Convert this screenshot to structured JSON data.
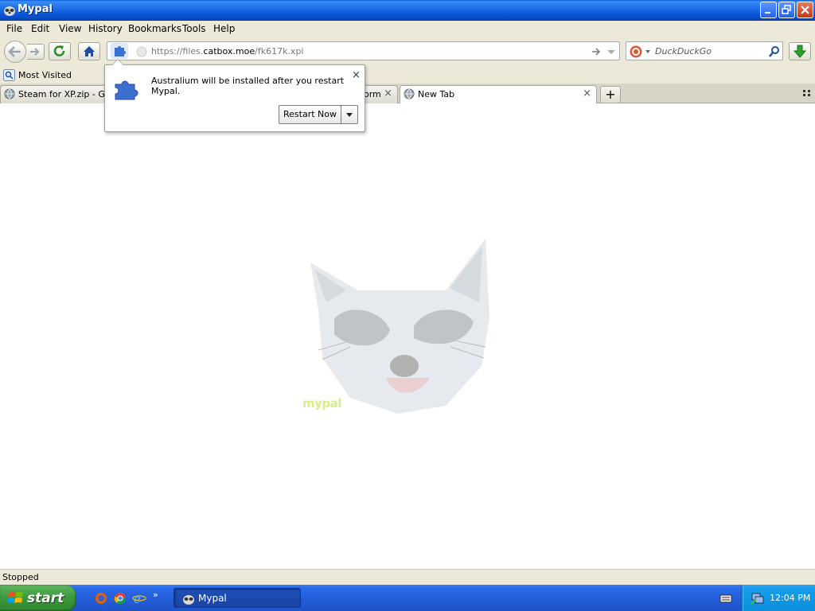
{
  "window": {
    "title": "Mypal"
  },
  "menu": {
    "items": [
      "File",
      "Edit",
      "View",
      "History",
      "Bookmarks",
      "Tools",
      "Help"
    ]
  },
  "navbar": {
    "url_prefix": "https://files.",
    "url_domain": "catbox.moe",
    "url_path": "/fk617k.xpi",
    "search_placeholder": "DuckDuckGo"
  },
  "bookmarks": {
    "most_visited": "Most Visited"
  },
  "tabs": [
    {
      "label": "Steam for XP.zip - Google"
    },
    {
      "label": "orm"
    },
    {
      "label": "New Tab"
    }
  ],
  "popup": {
    "message": "Australium will be installed after you restart Mypal.",
    "restart_label": "Restart Now",
    "close_glyph": "×"
  },
  "content": {
    "logo_text": "mypal"
  },
  "status": {
    "text": "Stopped"
  },
  "taskbar": {
    "start_label": "start",
    "task_label": "Mypal",
    "clock": "12:04 PM"
  }
}
